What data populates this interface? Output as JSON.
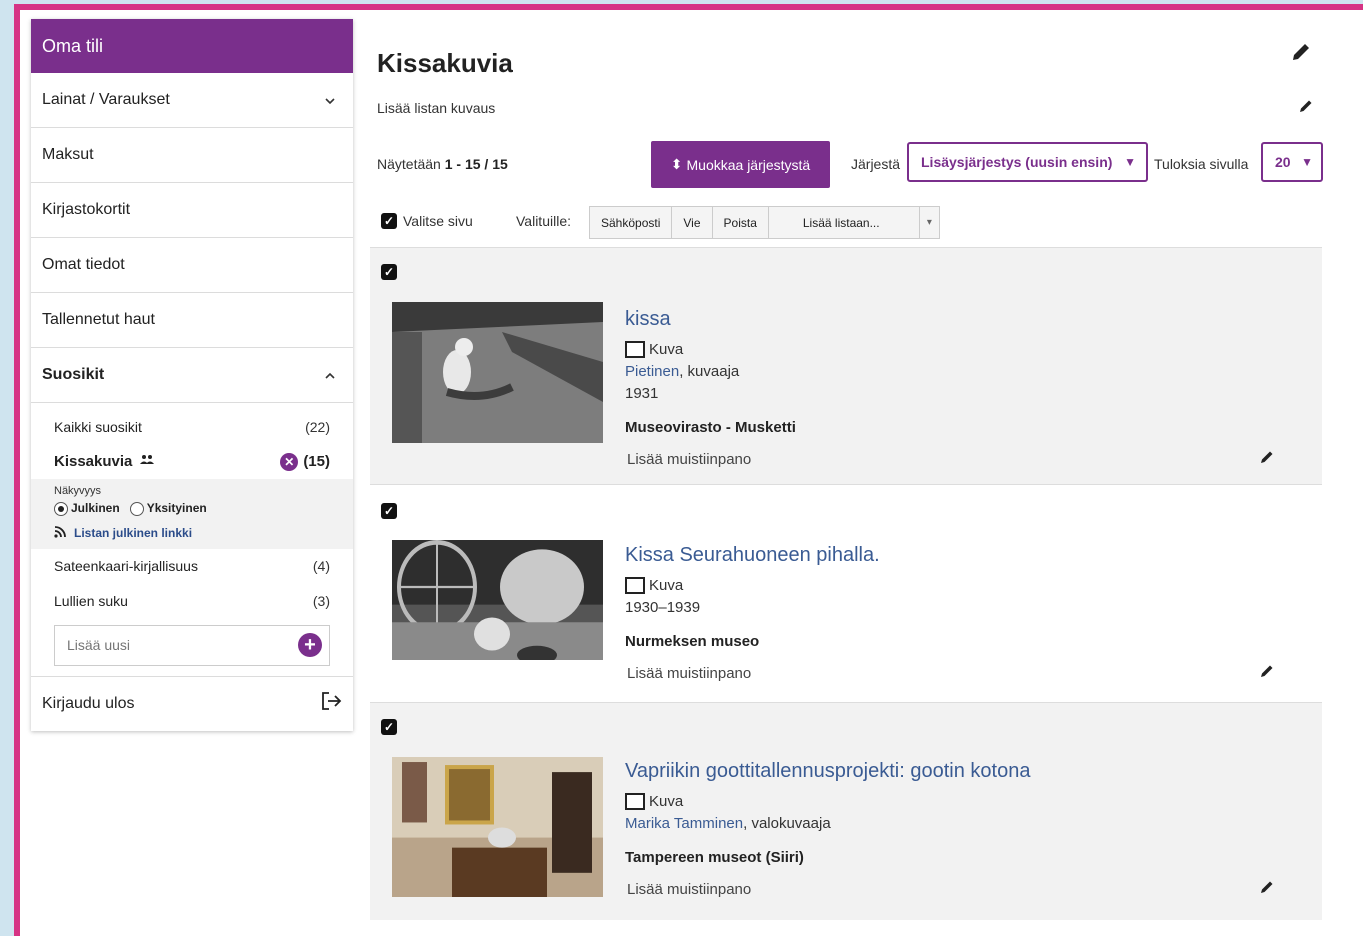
{
  "sidebar": {
    "header": "Oma tili",
    "items": [
      {
        "label": "Lainat / Varaukset"
      },
      {
        "label": "Maksut"
      },
      {
        "label": "Kirjastokortit"
      },
      {
        "label": "Omat tiedot"
      },
      {
        "label": "Tallennetut haut"
      },
      {
        "label": "Suosikit"
      }
    ],
    "favorites": [
      {
        "label": "Kaikki suosikit",
        "count": "(22)"
      },
      {
        "label": "Kissakuvia",
        "count": "(15)"
      },
      {
        "label": "Sateenkaari-kirjallisuus",
        "count": "(4)"
      },
      {
        "label": "Lullien suku",
        "count": "(3)"
      }
    ],
    "visibility_title": "Näkyvyys",
    "visibility_public": "Julkinen",
    "visibility_private": "Yksityinen",
    "public_link": "Listan julkinen linkki",
    "add_placeholder": "Lisää uusi",
    "logout": "Kirjaudu ulos"
  },
  "main": {
    "title": "Kissakuvia",
    "description": "Lisää listan kuvaus",
    "showing_prefix": "Näytetään",
    "showing_range": "1 - 15 / 15",
    "reorder_button": "Muokkaa järjestystä",
    "sort_label": "Järjestä",
    "sort_value": "Lisäysjärjestys (uusin ensin)",
    "perpage_label": "Tuloksia sivulla",
    "perpage_value": "20",
    "select_page": "Valitse sivu",
    "selected_label": "Valituille:",
    "bulk_email": "Sähköposti",
    "bulk_export": "Vie",
    "bulk_delete": "Poista",
    "bulk_add_list": "Lisää listaan..."
  },
  "records": [
    {
      "title": "kissa",
      "format": "Kuva",
      "author": "Pietinen",
      "author_role": ", kuvaaja",
      "year": "1931",
      "source": "Museovirasto - Musketti",
      "note": "Lisää muistiinpano"
    },
    {
      "title": "Kissa Seurahuoneen pihalla.",
      "format": "Kuva",
      "year": "1930–1939",
      "source": "Nurmeksen museo",
      "note": "Lisää muistiinpano"
    },
    {
      "title": "Vapriikin goottitallennusprojekti: gootin kotona",
      "format": "Kuva",
      "author": "Marika Tamminen",
      "author_role": ", valokuvaaja",
      "source": "Tampereen museot (Siiri)",
      "note": "Lisää muistiinpano"
    }
  ],
  "colors": {
    "brand": "#7a2f8c",
    "frame": "#d63384",
    "link": "#3a5b93"
  }
}
